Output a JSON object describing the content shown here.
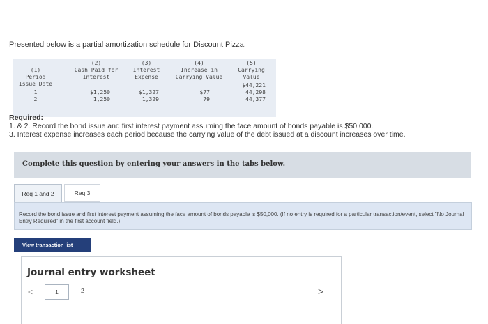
{
  "intro_text": "Presented below is a partial amortization schedule for Discount Pizza.",
  "schedule": {
    "headers": [
      "(1)\nPeriod\nIssue Date",
      "(2)\nCash Paid for\nInterest",
      "(3)\nInterest\nExpense",
      "(4)\nIncrease in\nCarrying Value",
      "(5)\nCarrying\nValue"
    ],
    "issue_carrying_value": "$44,221",
    "rows": [
      {
        "period": "1",
        "cash": "$1,250",
        "interest": "$1,327",
        "increase": "$77",
        "carrying": "44,298"
      },
      {
        "period": "2",
        "cash": "1,250",
        "interest": "1,329",
        "increase": "79",
        "carrying": "44,377"
      }
    ]
  },
  "required": {
    "heading": "Required:",
    "line1": "1. & 2. Record the bond issue and first interest payment assuming the face amount of bonds payable is $50,000.",
    "line2": "3. Interest expense increases each period because the carrying value of the debt issued at a discount increases over time."
  },
  "complete_banner": "Complete this question by entering your answers in the tabs below.",
  "tabs": [
    "Req 1 and 2",
    "Req 3"
  ],
  "instruction": "Record the bond issue and first interest payment assuming the face amount of bonds payable is $50,000. (If no entry is required for a particular transaction/event, select \"No Journal Entry Required\" in the first account field.)",
  "view_transaction_label": "View transaction list",
  "journal": {
    "title": "Journal entry worksheet",
    "prev_icon": "<",
    "next_icon": ">",
    "pages": [
      "1",
      "2"
    ]
  }
}
